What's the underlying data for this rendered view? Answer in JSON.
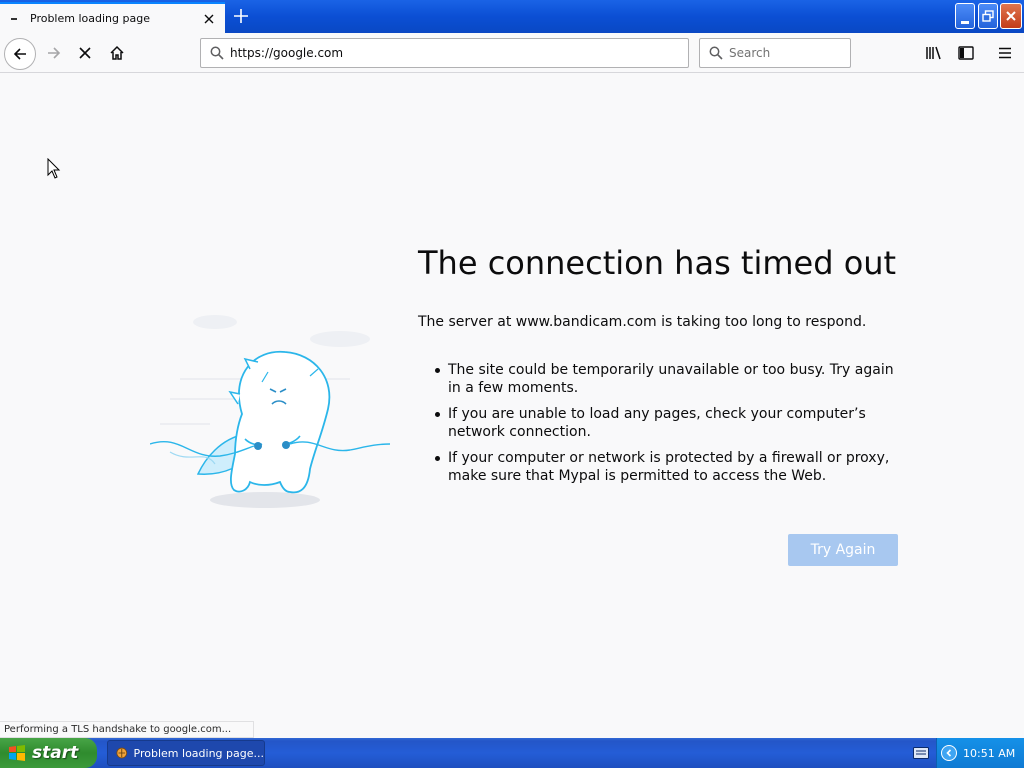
{
  "window": {
    "tab_title": "Problem loading page",
    "icons": {
      "tab_close": "close-icon",
      "new_tab": "plus-icon",
      "minimize": "minimize-icon",
      "restore": "restore-icon",
      "close": "close-icon"
    }
  },
  "toolbar": {
    "url": "https://google.com",
    "search_placeholder": "Search",
    "icons": [
      "back-arrow-icon",
      "forward-arrow-icon",
      "stop-icon",
      "home-icon",
      "library-icon",
      "sidebar-icon",
      "menu-icon"
    ]
  },
  "error": {
    "title": "The connection has timed out",
    "description": "The server at www.bandicam.com is taking too long to respond.",
    "reasons": [
      "The site could be temporarily unavailable or too busy. Try again in a few moments.",
      "If you are unable to load any pages, check your computer’s network connection.",
      "If your computer or network is protected by a firewall or proxy, make sure that Mypal is permitted to access the Web."
    ],
    "try_again_label": "Try Again"
  },
  "status": {
    "text": "Performing a TLS handshake to google.com..."
  },
  "taskbar": {
    "start_label": "start",
    "task_label": "Problem loading page...",
    "clock": "10:51 AM"
  },
  "colors": {
    "accent": "#0a84ff",
    "try_again_bg": "#a8c8f0",
    "taskbar_blue": "#245dd7",
    "start_green": "#3c9a3b",
    "tray_blue": "#0f7ad3"
  }
}
